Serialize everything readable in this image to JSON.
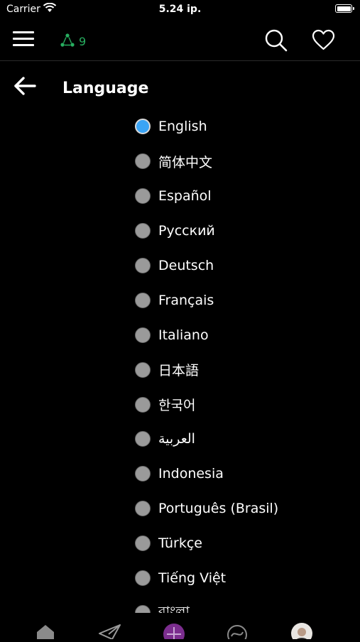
{
  "status": {
    "carrier": "Carrier",
    "time": "5.24 ip."
  },
  "header": {
    "network_count": "9"
  },
  "page": {
    "title": "Language"
  },
  "languages": [
    {
      "label": "English",
      "selected": true
    },
    {
      "label": "简体中文",
      "selected": false
    },
    {
      "label": "Español",
      "selected": false
    },
    {
      "label": "Русский",
      "selected": false
    },
    {
      "label": "Deutsch",
      "selected": false
    },
    {
      "label": "Français",
      "selected": false
    },
    {
      "label": "Italiano",
      "selected": false
    },
    {
      "label": "日本語",
      "selected": false
    },
    {
      "label": "한국어",
      "selected": false
    },
    {
      "label": "العربية",
      "selected": false
    },
    {
      "label": "Indonesia",
      "selected": false
    },
    {
      "label": "Português (Brasil)",
      "selected": false
    },
    {
      "label": "Türkçe",
      "selected": false
    },
    {
      "label": "Tiếng Việt",
      "selected": false
    },
    {
      "label": "বাংলা",
      "selected": false
    }
  ],
  "colors": {
    "accent_green": "#27ae60",
    "radio_selected": "#3aa4f5",
    "tab_purple": "#7b2d8e"
  },
  "icons": {
    "menu": "hamburger-menu-icon",
    "network": "network-nodes-icon",
    "search": "search-icon",
    "favorites": "heart-icon",
    "back": "arrow-left-icon",
    "tabs": [
      "home-icon",
      "paper-plane-icon",
      "add-icon",
      "explore-icon",
      "avatar"
    ]
  }
}
